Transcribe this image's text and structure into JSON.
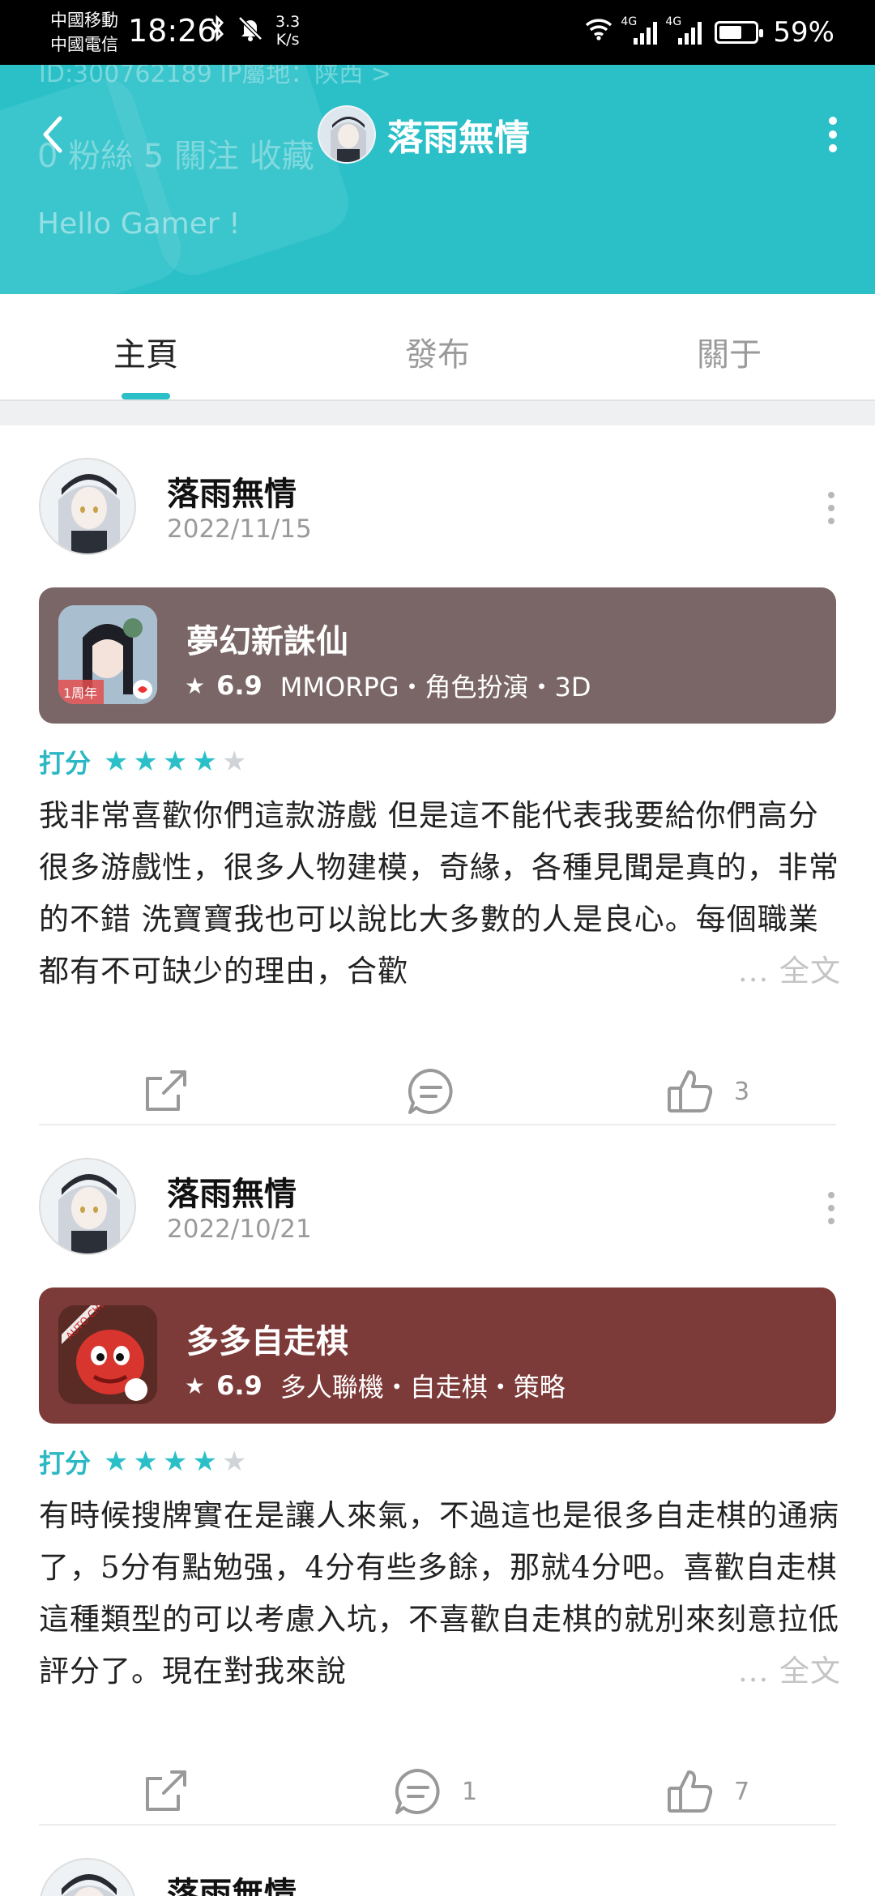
{
  "status_bar": {
    "carrier_1": "中國移動",
    "carrier_2": "中國電信",
    "time": "18:26",
    "net_speed_value": "3.3",
    "net_speed_unit": "K/s",
    "network_1": "4G",
    "network_2": "4G",
    "battery": "59%"
  },
  "header": {
    "title": "落雨無情",
    "ghost_id": "ID:300762189  IP屬地：陕西 >",
    "ghost_stats": "0 粉絲   5 關注   收藏",
    "ghost_greeting": "Hello Gamer !",
    "accent": "#2bc0c8"
  },
  "tabs": [
    {
      "label": "主頁",
      "active": true
    },
    {
      "label": "發布",
      "active": false
    },
    {
      "label": "關于",
      "active": false
    }
  ],
  "posts": [
    {
      "author": "落雨無情",
      "date": "2022/11/15",
      "game": {
        "name": "夢幻新誅仙",
        "score": "6.9",
        "tags": "MMORPG・角色扮演・3D",
        "icon_badge": "1周年",
        "card_color": "#7a6666"
      },
      "rating_label": "打分",
      "stars": 4,
      "review": "我非常喜歡你們這款游戲 但是這不能代表我要給你們高分 很多游戲性，很多人物建模，奇緣，各種見聞是真的，非常的不錯 洗寶寶我也可以說比大多數的人是良心。每個職業都有不可缺少的理由，合歡",
      "read_more": "... 全文",
      "comments": "",
      "likes": "3"
    },
    {
      "author": "落雨無情",
      "date": "2022/10/21",
      "game": {
        "name": "多多自走棋",
        "score": "6.9",
        "tags": "多人聯機・自走棋・策略",
        "icon_badge": "AUTO CHESS",
        "card_color": "#7c3a38"
      },
      "rating_label": "打分",
      "stars": 4,
      "review": "有時候搜牌實在是讓人來氣，不過這也是很多自走棋的通病了，5分有點勉强，4分有些多餘，那就4分吧。喜歡自走棋這種類型的可以考慮入坑，不喜歡自走棋的就別來刻意拉低評分了。現在對我來說",
      "read_more": "... 全文",
      "comments": "1",
      "likes": "7"
    },
    {
      "author": "落雨無情"
    }
  ]
}
